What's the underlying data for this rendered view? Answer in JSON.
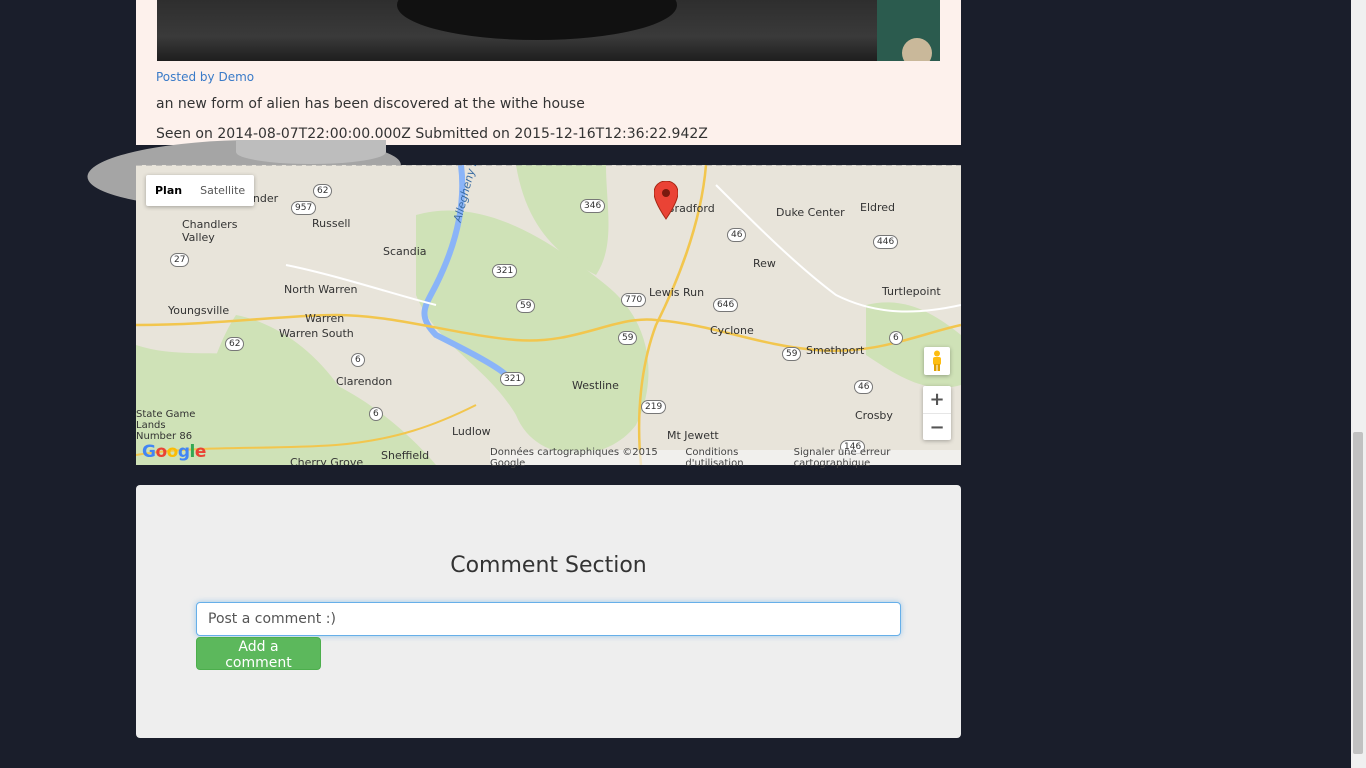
{
  "post": {
    "posted_by": "Posted by Demo",
    "description": "an new form of alien has been discovered at the withe house",
    "dates": "Seen on 2014-08-07T22:00:00.000Z Submitted on 2015-12-16T12:36:22.942Z"
  },
  "map": {
    "type_buttons": [
      "Plan",
      "Satellite"
    ],
    "towns": [
      "Lander",
      "Chandlers Valley",
      "Russell",
      "Scandia",
      "North Warren",
      "Youngsville",
      "Warren",
      "Warren South",
      "Clarendon",
      "State Game Lands Number 86",
      "Cherry Grove",
      "Sheffield",
      "Ludlow",
      "Westline",
      "Lewis Run",
      "Bradford",
      "Duke Center",
      "Eldred",
      "Rew",
      "Turtlepoint",
      "Cyclone",
      "Smethport",
      "Crosby",
      "Mt Jewett",
      "Allegheny Reservoir"
    ],
    "road_shields": [
      "62",
      "957",
      "346",
      "27",
      "321",
      "59",
      "770",
      "46",
      "446",
      "646",
      "6",
      "321",
      "219",
      "6",
      "46",
      "146",
      "59",
      "62",
      "6",
      "59"
    ],
    "attribution": [
      "Données cartographiques ©2015 Google",
      "Conditions d'utilisation",
      "Signaler une erreur cartographique"
    ],
    "zoom_in": "+",
    "zoom_out": "−",
    "logo": "Google"
  },
  "comments": {
    "title": "Comment Section",
    "input_placeholder": "Post a comment :)",
    "add_button": "Add a comment"
  },
  "colors": {
    "page_background": "#1a1e2b",
    "post_card": "#fdf1ec",
    "link": "#3a7bc8",
    "button_green": "#5cb85c"
  }
}
